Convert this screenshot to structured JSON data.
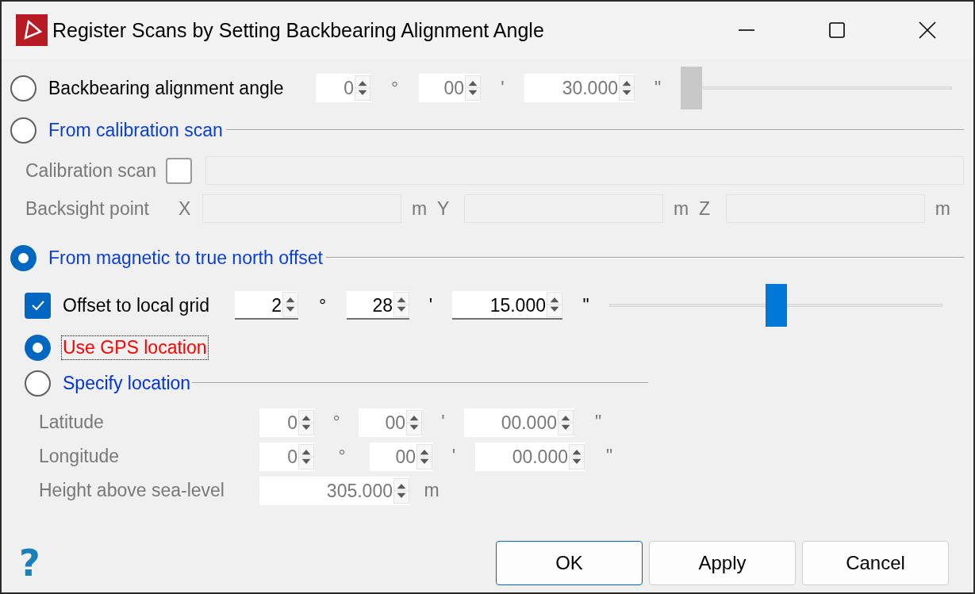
{
  "window": {
    "title": "Register Scans by Setting Backbearing Alignment Angle"
  },
  "backbearing": {
    "label": "Backbearing alignment angle",
    "selected": false,
    "disabled": true,
    "angle": [
      {
        "value": "0",
        "unit": "°"
      },
      {
        "value": "00",
        "unit": "'"
      },
      {
        "value": "30.000",
        "unit": "\""
      }
    ],
    "slider": {
      "level": 0
    }
  },
  "calibration": {
    "label": "From calibration scan",
    "selected": false,
    "disabled": true,
    "scan": {
      "label": "Calibration scan",
      "checked": false
    },
    "backsight": {
      "label": "Backsight point",
      "axes": [
        {
          "label": "X",
          "unit": "m"
        },
        {
          "label": "Y",
          "unit": "m"
        },
        {
          "label": "Z",
          "unit": "m"
        }
      ]
    }
  },
  "magnetic": {
    "label": "From magnetic to true north offset",
    "selected": true,
    "offset": {
      "label": "Offset to local grid",
      "checked": true,
      "angle": [
        {
          "value": "2",
          "unit": "°"
        },
        {
          "value": "28",
          "unit": "'"
        },
        {
          "value": "15.000",
          "unit": "\""
        }
      ],
      "slider": {
        "level": 0.5
      }
    },
    "location_options": [
      {
        "label": "Use GPS location",
        "selected": true,
        "focused": true,
        "color": "#ff0000"
      },
      {
        "label": "Specify location",
        "selected": false,
        "focused": false,
        "color": "#0033dd"
      }
    ],
    "location": {
      "disabled": true,
      "fields": [
        {
          "label": "Latitude",
          "kind": "angle",
          "angle": [
            {
              "value": "0",
              "unit": "°"
            },
            {
              "value": "00",
              "unit": "'"
            },
            {
              "value": "00.000",
              "unit": "\""
            }
          ]
        },
        {
          "label": "Longitude",
          "kind": "angle",
          "angle": [
            {
              "value": "0",
              "unit": "°"
            },
            {
              "value": "00",
              "unit": "'"
            },
            {
              "value": "00.000",
              "unit": "\""
            }
          ]
        },
        {
          "label": "Height above sea-level",
          "kind": "distance",
          "value": "305.000",
          "unit": "m"
        }
      ]
    }
  },
  "help": "?",
  "buttons": [
    {
      "label": "OK",
      "default": true
    },
    {
      "label": "Apply",
      "default": false
    },
    {
      "label": "Cancel",
      "default": false
    }
  ]
}
